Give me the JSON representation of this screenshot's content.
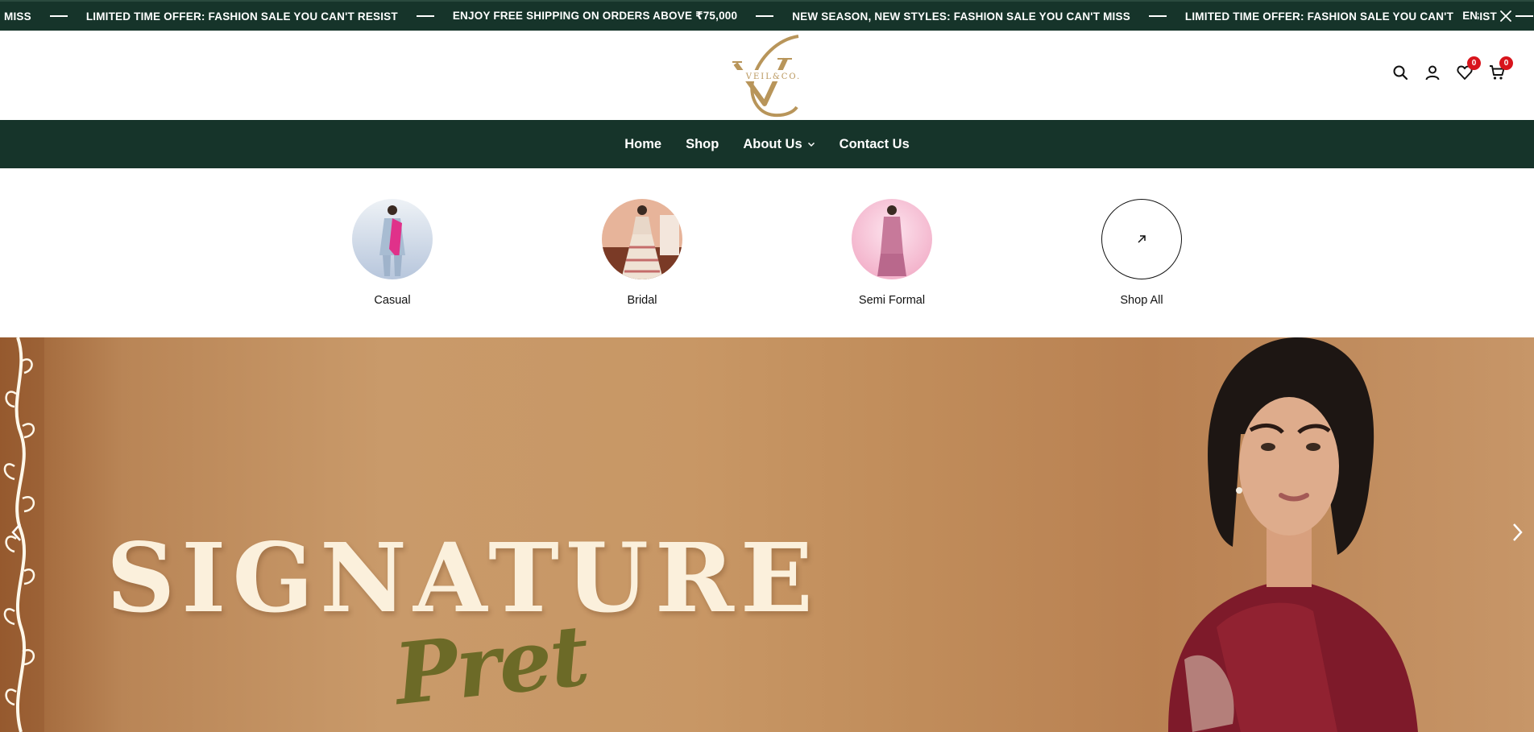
{
  "announcement": {
    "messages": [
      "MISS",
      "LIMITED TIME OFFER: FASHION SALE YOU CAN'T RESIST",
      "ENJOY FREE SHIPPING ON ORDERS ABOVE ₹75,000",
      "NEW SEASON, NEW STYLES: FASHION SALE YOU CAN'T MISS",
      "LIMITED TIME OFFER: FASHION SALE YOU CAN'T RESIST"
    ],
    "language": "EN",
    "close_icon": "close-icon"
  },
  "header": {
    "logo_text": "VEIL&CO.",
    "logo_monogram": "VC",
    "icons": [
      "search-icon",
      "account-icon",
      "wishlist-icon",
      "cart-icon"
    ],
    "wishlist_count": "0",
    "cart_count": "0",
    "badge_color": "#d8141c"
  },
  "nav": {
    "items": [
      {
        "label": "Home"
      },
      {
        "label": "Shop"
      },
      {
        "label": "About Us"
      },
      {
        "label": "Contact Us"
      }
    ],
    "background": "#16342a"
  },
  "categories": [
    {
      "label": "Casual"
    },
    {
      "label": "Bridal"
    },
    {
      "label": "Semi Formal"
    },
    {
      "label": "Shop All"
    }
  ],
  "hero": {
    "title": "SIGNATURE",
    "subtitle": "Pret",
    "prev_icon": "chevron-left-icon",
    "next_icon": "chevron-right-icon"
  },
  "colors": {
    "brand_green": "#16342a",
    "gold": "#b8955a",
    "hero_text": "#fbf0dc",
    "hero_script": "#6c6a27"
  }
}
